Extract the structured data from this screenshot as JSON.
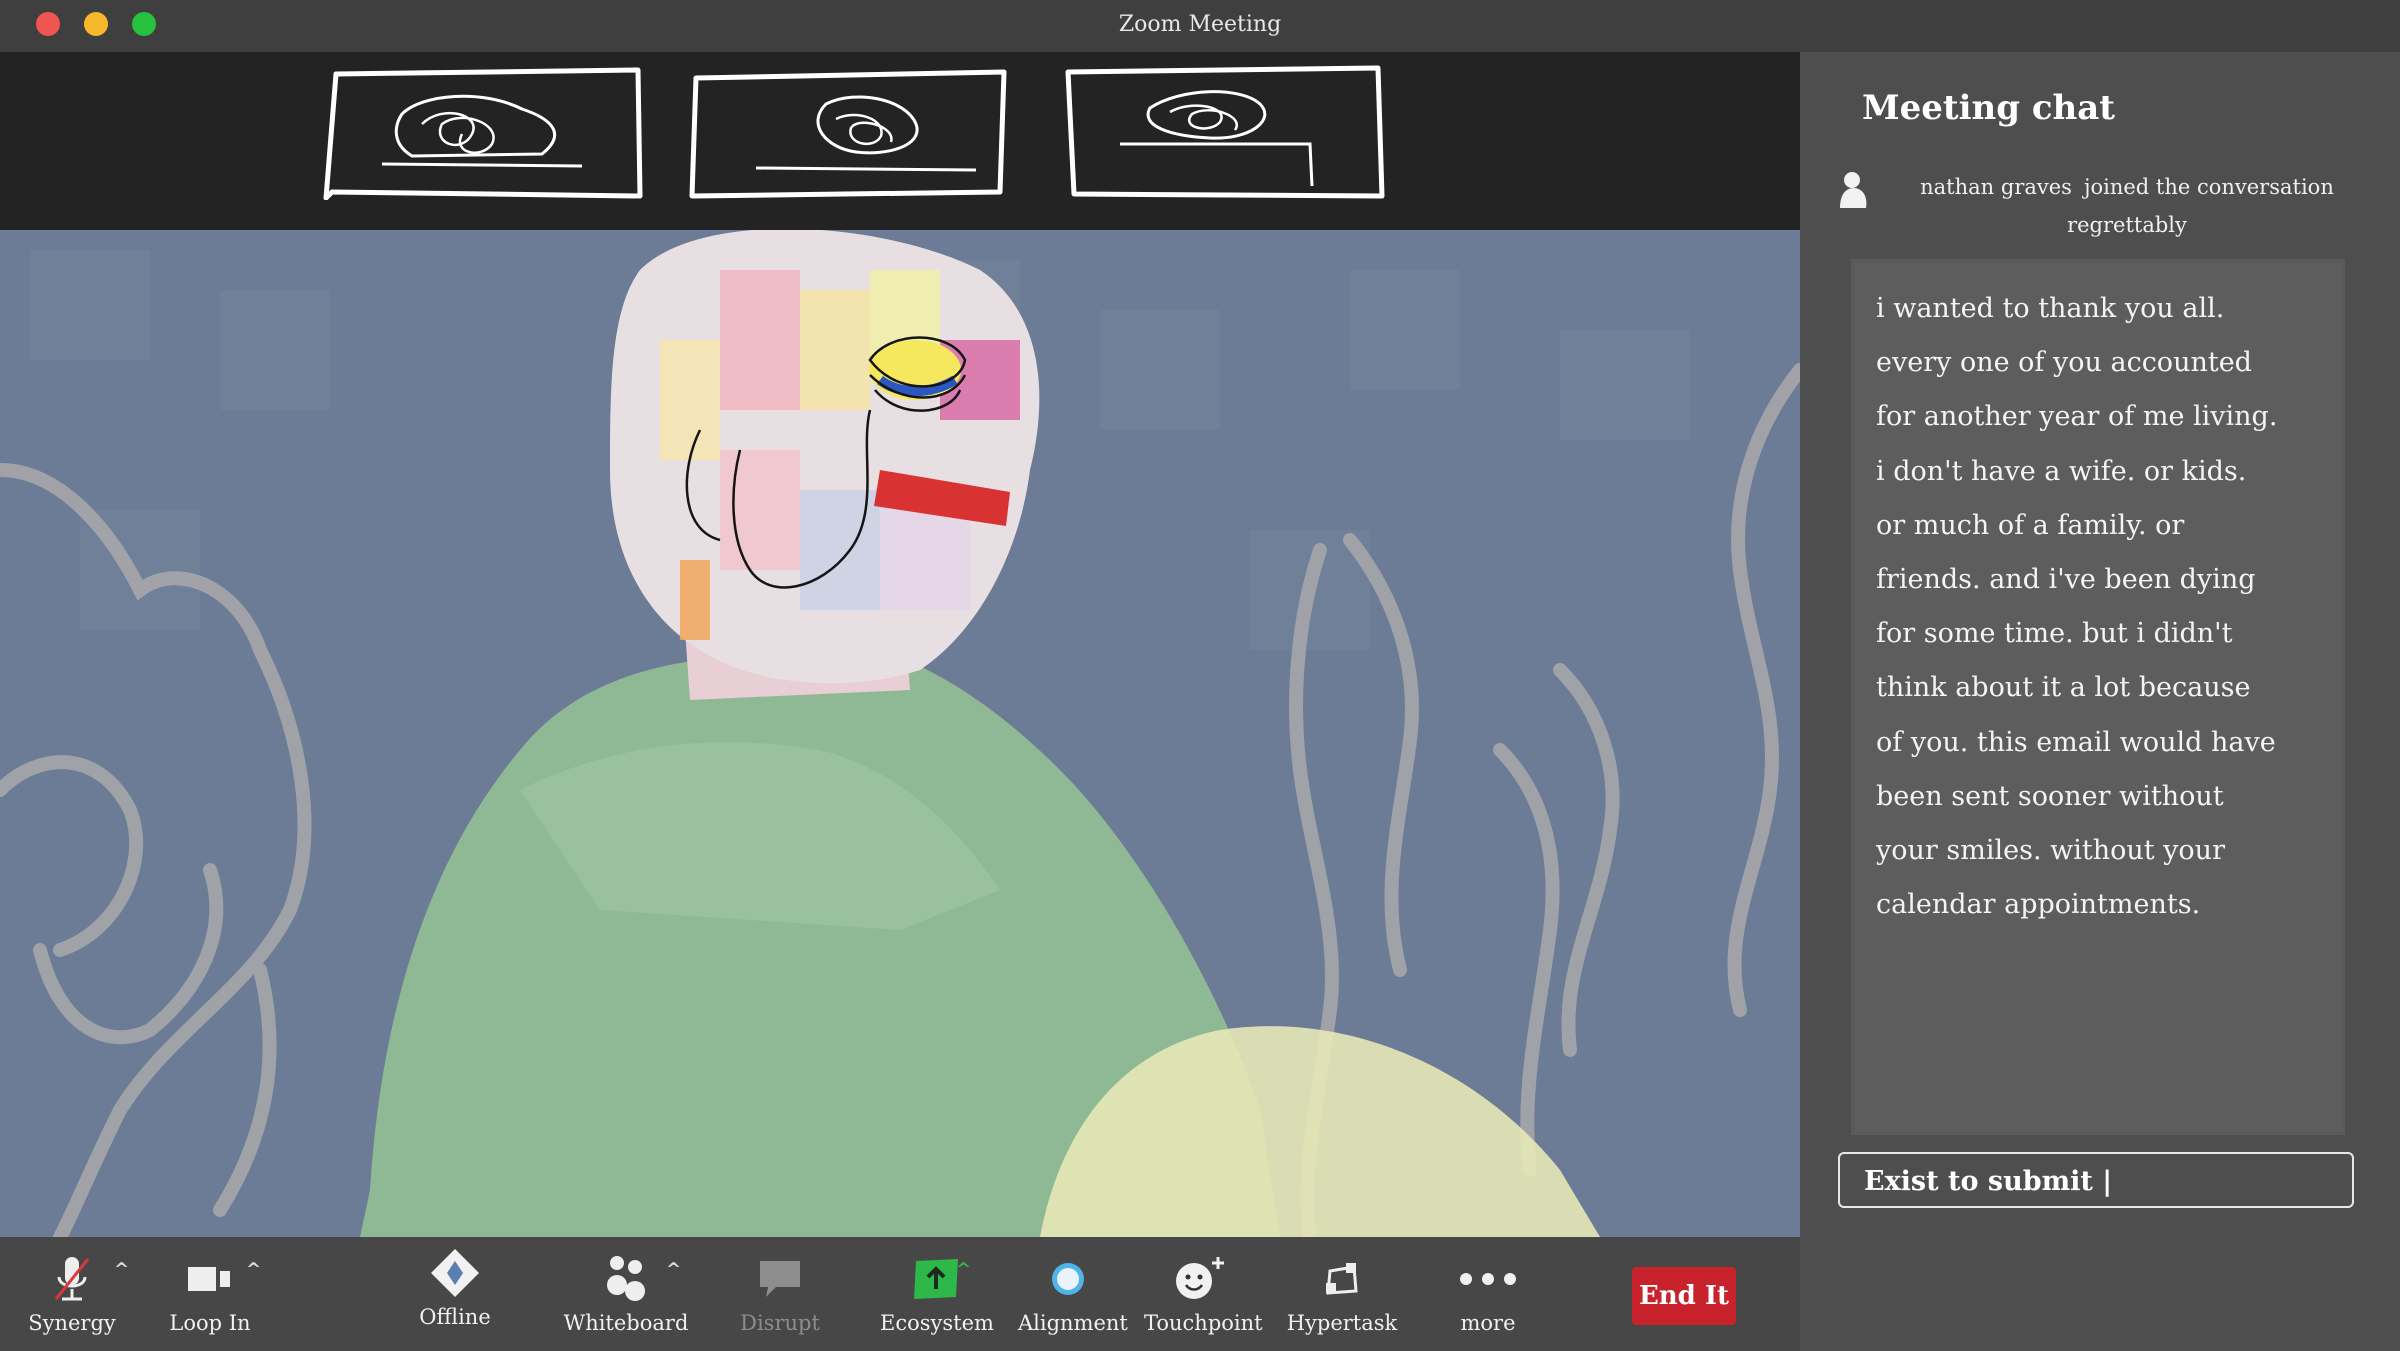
{
  "window": {
    "title": "Zoom Meeting"
  },
  "chat": {
    "title": "Meeting chat",
    "join_name": "nathan graves",
    "join_action": "joined the conversation",
    "join_suffix": "regrettably",
    "message": "i wanted to thank you all.\nevery one of you accounted\nfor another year of me living.\ni don't have a wife. or kids.\nor much of a family. or\nfriends. and i've been dying\nfor some time. but i didn't\nthink about it a lot because\nof you. this email would have\nbeen sent sooner without\nyour smiles. without your\ncalendar appointments.",
    "input_value": "Exist to submit |"
  },
  "toolbar": {
    "synergy": "Synergy",
    "loop_in": "Loop In",
    "offline": "Offline",
    "whiteboard": "Whiteboard",
    "disrupt": "Disrupt",
    "ecosystem": "Ecosystem",
    "alignment": "Alignment",
    "touchpoint": "Touchpoint",
    "hypertask": "Hypertask",
    "more": "more",
    "end": "End It",
    "caret": "^"
  },
  "colors": {
    "end_button": "#c8232c",
    "ecosystem_icon": "#2fb84a",
    "alignment_icon": "#4fb4e6",
    "video_bg": "#6c7b96"
  },
  "icons": {
    "synergy": "microphone-muted-icon",
    "loop_in": "video-camera-icon",
    "offline": "diamond-icon",
    "whiteboard": "participants-icon",
    "disrupt": "speech-bubble-icon",
    "ecosystem": "share-screen-icon",
    "alignment": "circle-icon",
    "touchpoint": "smiley-plus-icon",
    "hypertask": "apps-icon",
    "more": "ellipsis-icon"
  }
}
